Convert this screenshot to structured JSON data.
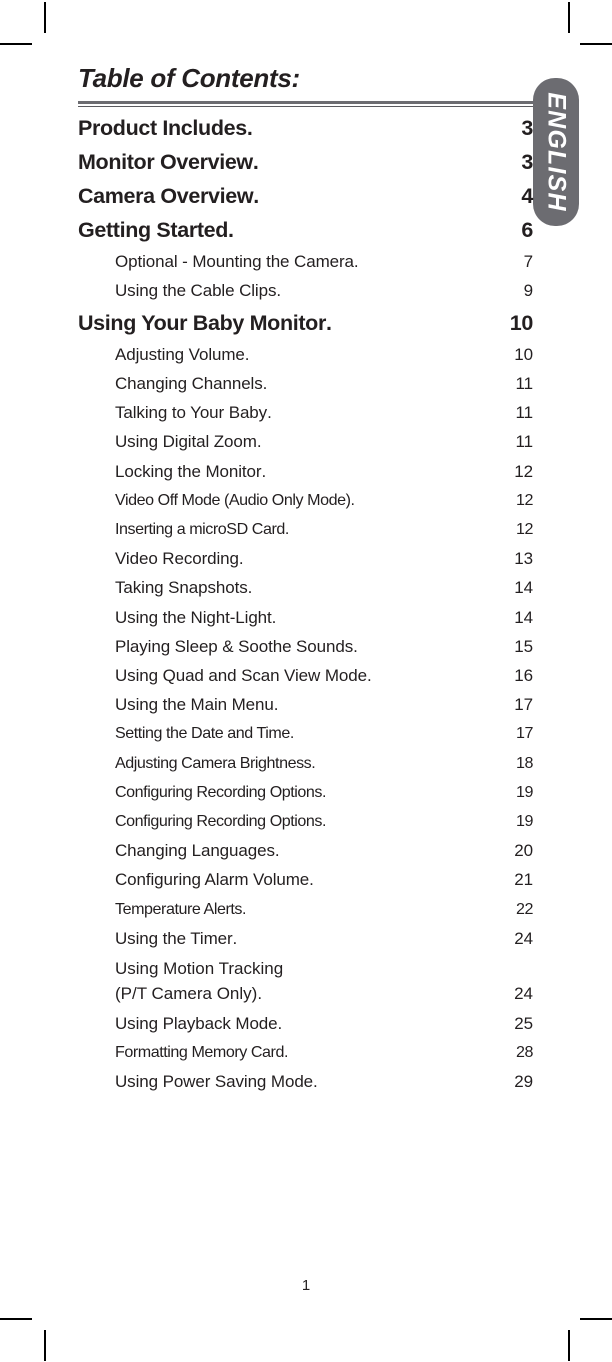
{
  "document": {
    "title": "Table of Contents:",
    "folio": "1",
    "language_tab": "ENGLISH",
    "leader_char": ".",
    "colors": {
      "tab_gray": "#6c6c71",
      "rule_gray": "#6c6c71",
      "text": "#231f20"
    }
  },
  "toc": {
    "entries": [
      {
        "label": "Product Includes",
        "page": "3",
        "level": "major",
        "leader": "................................"
      },
      {
        "label": "Monitor Overview",
        "page": "3",
        "level": "major",
        "leader": "................................"
      },
      {
        "label": "Camera Overview",
        "page": "4",
        "level": "major",
        "leader": "................................"
      },
      {
        "label": "Getting Started",
        "page": "6",
        "level": "major",
        "leader": "................................"
      },
      {
        "label": "Optional - Mounting the Camera",
        "page": "7",
        "level": "minor",
        "leader": "................................"
      },
      {
        "label": "Using the Cable Clips",
        "page": "9",
        "level": "minor",
        "leader": "................................"
      },
      {
        "label": "Using Your Baby Monitor",
        "page": "10",
        "level": "major",
        "leader": "................................"
      },
      {
        "label": "Adjusting Volume",
        "page": "10",
        "level": "minor",
        "leader": "................................"
      },
      {
        "label": "Changing Channels",
        "page": "11",
        "level": "minor",
        "leader": "................................"
      },
      {
        "label": "Talking to Your Baby",
        "page": "11",
        "level": "minor",
        "leader": "................................"
      },
      {
        "label": "Using Digital Zoom",
        "page": "11",
        "level": "minor",
        "leader": "................................"
      },
      {
        "label": "Locking the Monitor",
        "page": "12",
        "level": "minor",
        "leader": "................................"
      },
      {
        "label": "Video Off Mode (Audio Only Mode)",
        "page": "12",
        "level": "minor-tight",
        "leader": "................................"
      },
      {
        "label": "Inserting a microSD Card",
        "page": "12",
        "level": "minor-tight",
        "leader": "................................"
      },
      {
        "label": "Video Recording",
        "page": "13",
        "level": "minor",
        "leader": "................................"
      },
      {
        "label": "Taking Snapshots",
        "page": "14",
        "level": "minor",
        "leader": "................................"
      },
      {
        "label": "Using the Night-Light",
        "page": "14",
        "level": "minor",
        "leader": "................................"
      },
      {
        "label": "Playing Sleep & Soothe Sounds",
        "page": "15",
        "level": "minor",
        "leader": "................................"
      },
      {
        "label": "Using Quad and Scan View Mode",
        "page": "16",
        "level": "minor",
        "leader": "................................"
      },
      {
        "label": "Using the Main Menu",
        "page": "17",
        "level": "minor",
        "leader": "................................"
      },
      {
        "label": "Setting the Date and Time",
        "page": "17",
        "level": "minor-tight",
        "leader": "................................"
      },
      {
        "label": "Adjusting Camera Brightness",
        "page": "18",
        "level": "minor-tight",
        "leader": "................................"
      },
      {
        "label": "Configuring Recording Options",
        "page": "19",
        "level": "minor-tight",
        "leader": "................................"
      },
      {
        "label": "Configuring Recording Options",
        "page": "19",
        "level": "minor-tight",
        "leader": "................................"
      },
      {
        "label": "Changing Languages",
        "page": "20",
        "level": "minor",
        "leader": "................................"
      },
      {
        "label": "Configuring Alarm Volume",
        "page": "21",
        "level": "minor",
        "leader": "................................"
      },
      {
        "label": "Temperature Alerts",
        "page": "22",
        "level": "minor-tight",
        "leader": "................................"
      },
      {
        "label": "Using the Timer",
        "page": "24",
        "level": "minor",
        "leader": "................................"
      },
      {
        "label": "Using Motion Tracking",
        "label2": "(P/T Camera Only)",
        "page": "24",
        "level": "twoline",
        "leader": "................................"
      },
      {
        "label": "Using Playback Mode",
        "page": "25",
        "level": "minor",
        "leader": "................................"
      },
      {
        "label": "Formatting Memory Card",
        "page": "28",
        "level": "minor-tight",
        "leader": "................................"
      },
      {
        "label": "Using Power Saving Mode",
        "page": "29",
        "level": "minor",
        "leader": "................................"
      }
    ]
  }
}
